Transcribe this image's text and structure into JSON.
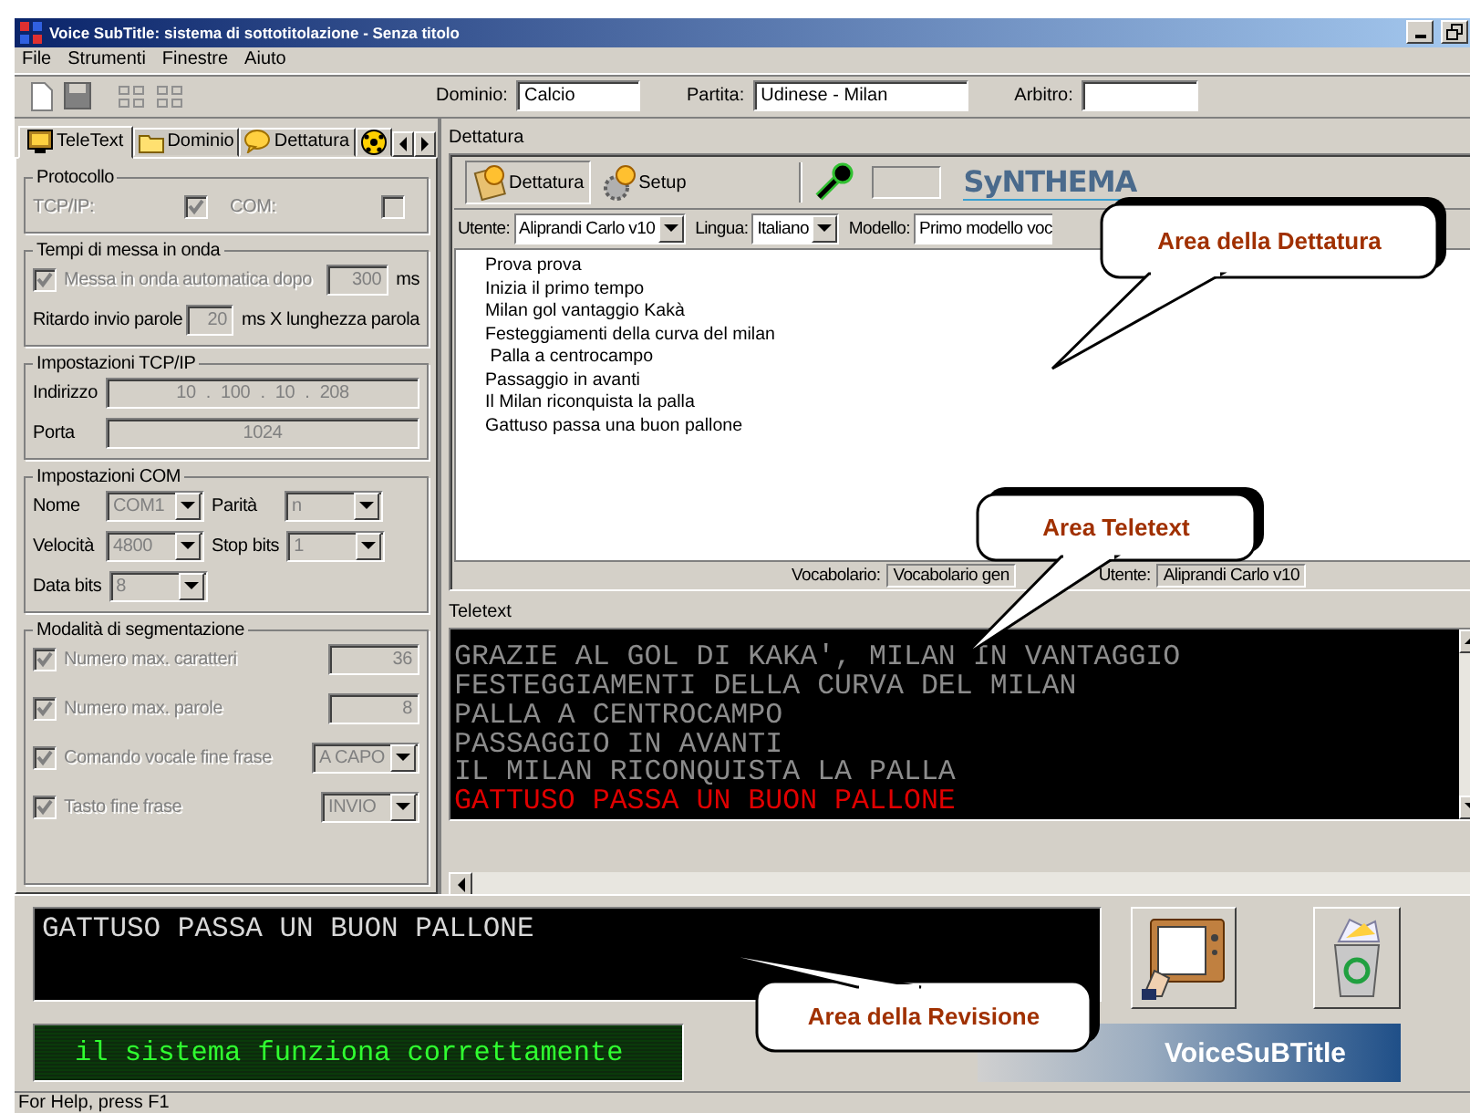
{
  "window": {
    "title": "Voice SubTitle: sistema di sottotitolazione - Senza titolo"
  },
  "menu": [
    "File",
    "Strumenti",
    "Finestre",
    "Aiuto"
  ],
  "toolbar": {
    "fields": [
      {
        "label": "Dominio:",
        "value": "Calcio"
      },
      {
        "label": "Partita:",
        "value": "Udinese - Milan"
      },
      {
        "label": "Arbitro:"
      }
    ]
  },
  "left_tabs": [
    {
      "label": "TeleText",
      "selected": true,
      "kind": "monitor"
    },
    {
      "label": "Dominio",
      "selected": false,
      "kind": "folder"
    },
    {
      "label": "Dettatura",
      "selected": false,
      "kind": "bubble"
    },
    {
      "selected": false,
      "kind": "ball"
    }
  ],
  "groups": [
    {
      "title": "Protocollo",
      "lines": [
        {
          "items": [
            {
              "kind": "label",
              "text": "TCP/IP:",
              "disabled": true
            },
            {
              "kind": "check",
              "checked": true,
              "disabled": true
            },
            {
              "kind": "label",
              "text": "COM:",
              "disabled": true
            },
            {
              "kind": "check",
              "checked": false,
              "disabled": true
            }
          ]
        }
      ]
    },
    {
      "title": "Tempi di messa in onda",
      "lines": [
        {
          "items": [
            {
              "kind": "check",
              "text": "Messa in onda automatica dopo",
              "checked": true,
              "disabled": true
            },
            {
              "kind": "field",
              "text": "300"
            },
            {
              "kind": "unit",
              "text": "ms"
            }
          ]
        },
        {
          "items": [
            {
              "kind": "label",
              "text": "Ritardo invio parole",
              "disabled": false
            },
            {
              "kind": "field",
              "text": "20"
            },
            {
              "kind": "unit",
              "text": "ms X lunghezza parola"
            }
          ]
        }
      ]
    },
    {
      "title": "Impostazioni TCP/IP",
      "lines": [
        {
          "items": [
            {
              "kind": "label",
              "text": "Indirizzo",
              "disabled": false
            },
            {
              "kind": "wide",
              "text": "10 . 100 . 10 . 208"
            }
          ]
        },
        {
          "items": [
            {
              "kind": "label",
              "text": "Porta",
              "disabled": false
            },
            {
              "kind": "wide",
              "text": "1024"
            }
          ]
        }
      ]
    },
    {
      "title": "Impostazioni COM",
      "lines": [
        {
          "items": [
            {
              "kind": "label",
              "text": "Nome",
              "disabled": false
            },
            {
              "kind": "combo",
              "text": "COM1"
            },
            {
              "kind": "label",
              "text": "Parità",
              "disabled": false
            },
            {
              "kind": "combo",
              "text": "n"
            }
          ]
        },
        {
          "items": [
            {
              "kind": "label",
              "text": "Velocità",
              "disabled": false
            },
            {
              "kind": "combo",
              "text": "4800"
            },
            {
              "kind": "label",
              "text": "Stop bits",
              "disabled": false
            },
            {
              "kind": "combo",
              "text": "1"
            }
          ]
        },
        {
          "items": [
            {
              "kind": "label",
              "text": "Data bits",
              "disabled": false
            },
            {
              "kind": "combo",
              "text": "8"
            }
          ]
        }
      ]
    },
    {
      "title": "Modalità di segmentazione",
      "lines": [
        {
          "items": [
            {
              "kind": "check",
              "text": "Numero max. caratteri",
              "checked": true,
              "disabled": true
            },
            {
              "kind": "field",
              "text": "36"
            }
          ]
        },
        {
          "items": [
            {
              "kind": "check",
              "text": "Numero max. parole",
              "checked": true,
              "disabled": true
            },
            {
              "kind": "field",
              "text": "8"
            }
          ]
        },
        {
          "items": [
            {
              "kind": "check",
              "text": "Comando vocale fine frase",
              "checked": true,
              "disabled": true
            },
            {
              "kind": "combo",
              "text": "A CAPO"
            }
          ]
        },
        {
          "items": [
            {
              "kind": "check",
              "text": "Tasto fine frase",
              "checked": true,
              "disabled": true
            },
            {
              "kind": "combo",
              "text": "INVIO"
            }
          ]
        }
      ]
    }
  ],
  "dictation": {
    "label": "Dettatura",
    "buttons": [
      {
        "label": "Dettatura",
        "selected": true
      },
      {
        "label": "Setup",
        "selected": false
      }
    ],
    "logo": "SyNTHEMA",
    "selectors": [
      {
        "label": "Utente:",
        "value": "Aliprandi Carlo v10"
      },
      {
        "label": "Lingua:",
        "value": "Italiano"
      },
      {
        "label": "Modello:",
        "value": "Primo modello voc"
      }
    ],
    "lines": [
      "Prova prova",
      "Inizia il primo tempo",
      "Milan gol vantaggio Kakà",
      "Festeggiamenti della curva del milan",
      " Palla a centrocampo",
      "Passaggio in avanti",
      "Il Milan riconquista la palla",
      "Gattuso passa una buon pallone"
    ],
    "status": [
      {
        "label": "Vocabolario:",
        "value": "Vocabolario gen"
      },
      {
        "label": "Utente:",
        "value": "Aliprandi Carlo v10"
      }
    ]
  },
  "teletext": {
    "label": "Teletext",
    "lines": [
      {
        "text": "GRAZIE AL GOL DI KAKA', MILAN IN VANTAGGIO",
        "current": false
      },
      {
        "text": "FESTEGGIAMENTI DELLA CURVA DEL MILAN",
        "current": false
      },
      {
        "text": "PALLA A CENTROCAMPO",
        "current": false
      },
      {
        "text": "PASSAGGIO IN AVANTI",
        "current": false
      },
      {
        "text": "IL MILAN RICONQUISTA LA PALLA",
        "current": false
      },
      {
        "text": "GATTUSO PASSA UN BUON PALLONE",
        "current": true
      }
    ]
  },
  "revision": {
    "text": "GATTUSO PASSA UN BUON PALLONE"
  },
  "system_message": "il sistema funziona correttamente",
  "banner": "VoiceSuBTitle",
  "callouts": [
    "Area della Dettatura",
    "Area Teletext",
    "Area della Revisione"
  ],
  "status_bar": "For Help, press F1"
}
